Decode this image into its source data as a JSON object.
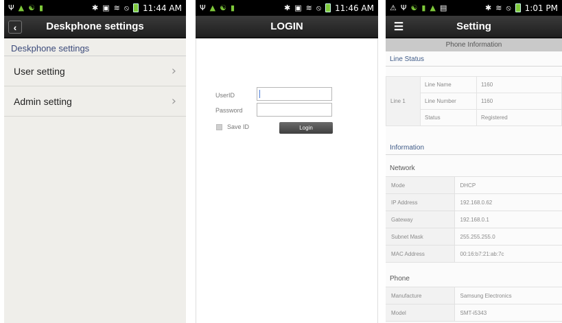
{
  "panel1": {
    "status_time": "11:44 AM",
    "title": "Deskphone settings",
    "section_header": "Deskphone settings",
    "items": [
      {
        "label": "User setting"
      },
      {
        "label": "Admin setting"
      }
    ]
  },
  "panel2": {
    "status_time": "11:46 AM",
    "title": "LOGIN",
    "userid_label": "UserID",
    "password_label": "Password",
    "save_id_label": "Save ID",
    "login_button": "Login"
  },
  "panel3": {
    "status_time": "1:01 PM",
    "title": "Setting",
    "banner": "Phone Information",
    "line_status_header": "Line Status",
    "line_label": "Line 1",
    "line_rows": [
      {
        "key": "Line Name",
        "value": "1160"
      },
      {
        "key": "Line Number",
        "value": "1160"
      },
      {
        "key": "Status",
        "value": "Registered"
      }
    ],
    "information_header": "Information",
    "network_sub": "Network",
    "network_rows": [
      {
        "key": "Mode",
        "value": "DHCP"
      },
      {
        "key": "IP Address",
        "value": "192.168.0.62"
      },
      {
        "key": "Gateway",
        "value": "192.168.0.1"
      },
      {
        "key": "Subnet Mask",
        "value": "255.255.255.0"
      },
      {
        "key": "MAC Address",
        "value": "00:16:b7:21:ab:7c"
      }
    ],
    "phone_sub": "Phone",
    "phone_rows": [
      {
        "key": "Manufacture",
        "value": "Samsung Electronics"
      },
      {
        "key": "Model",
        "value": "SMT-i5343"
      }
    ]
  },
  "colors": {
    "title_bar": "#2a2a2a",
    "section_header_text": "#3b4a7a",
    "status_bar_icons_green": "#7ec83a"
  }
}
